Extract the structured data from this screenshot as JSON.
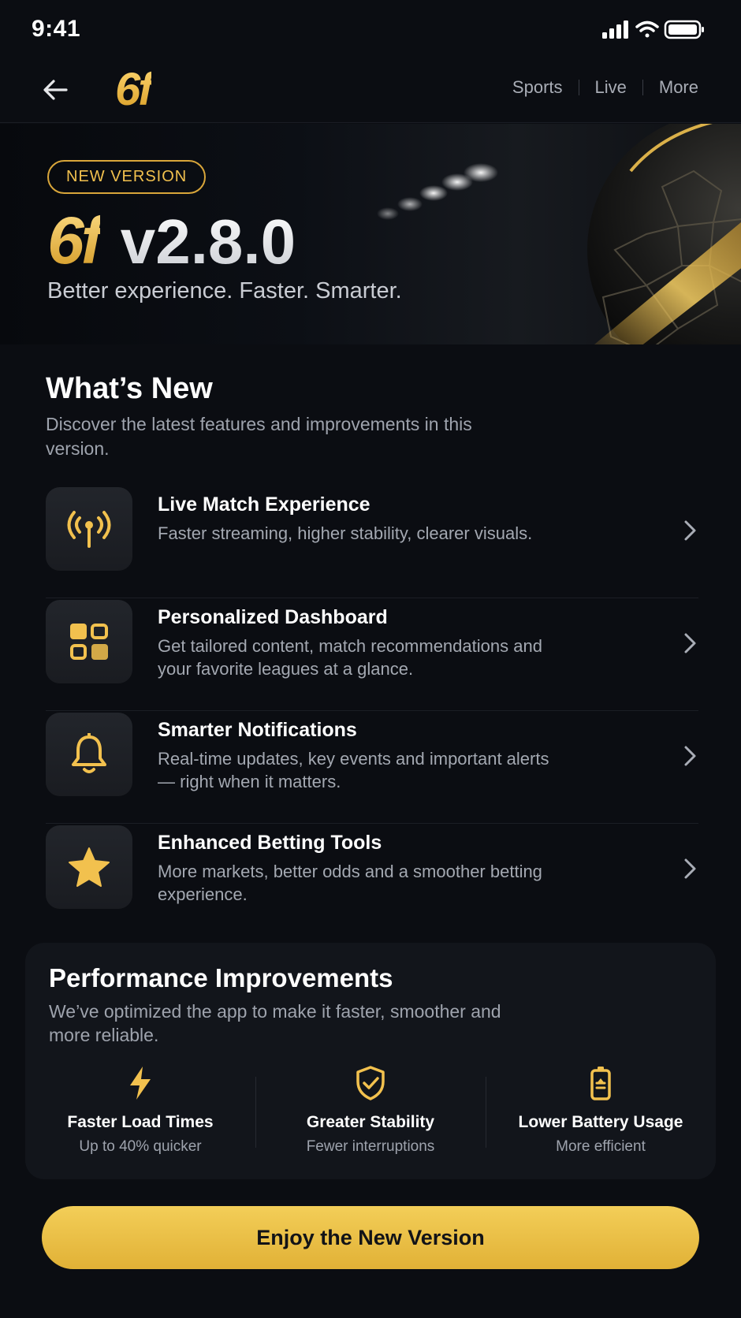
{
  "status_bar": {
    "time": "9:41"
  },
  "nav": {
    "logo": "6f",
    "links": [
      "Sports",
      "Live",
      "More"
    ]
  },
  "hero": {
    "badge": "NEW VERSION",
    "logo": "6f",
    "version": "v2.8.0",
    "subtitle": "Better experience. Faster. Smarter."
  },
  "whats_new": {
    "title": "What’s New",
    "description": "Discover the latest features and improvements in this version.",
    "features": [
      {
        "icon": "live-broadcast-icon",
        "title": "Live Match Experience",
        "description": "Faster streaming, higher stability, clearer visuals."
      },
      {
        "icon": "dashboard-grid-icon",
        "title": "Personalized Dashboard",
        "description": "Get tailored content, match recommendations and your favorite leagues at a glance."
      },
      {
        "icon": "bell-icon",
        "title": "Smarter Notifications",
        "description": "Real-time updates, key events and important alerts — right when it matters."
      },
      {
        "icon": "star-icon",
        "title": "Enhanced Betting Tools",
        "description": "More markets, better odds and a smoother betting experience."
      }
    ]
  },
  "performance": {
    "title": "Performance Improvements",
    "description": "We’ve optimized the app to make it faster, smoother and more reliable.",
    "stats": [
      {
        "icon": "lightning-icon",
        "title": "Faster Load Times",
        "subtitle": "Up to 40% quicker"
      },
      {
        "icon": "shield-check-icon",
        "title": "Greater Stability",
        "subtitle": "Fewer interruptions"
      },
      {
        "icon": "battery-icon",
        "title": "Lower Battery Usage",
        "subtitle": "More efficient"
      }
    ]
  },
  "cta": {
    "label": "Enjoy the New Version"
  },
  "colors": {
    "accent": "#f2c14e",
    "background": "#0b0d12",
    "card": "#12151b",
    "muted_text": "#9ea3ad"
  }
}
